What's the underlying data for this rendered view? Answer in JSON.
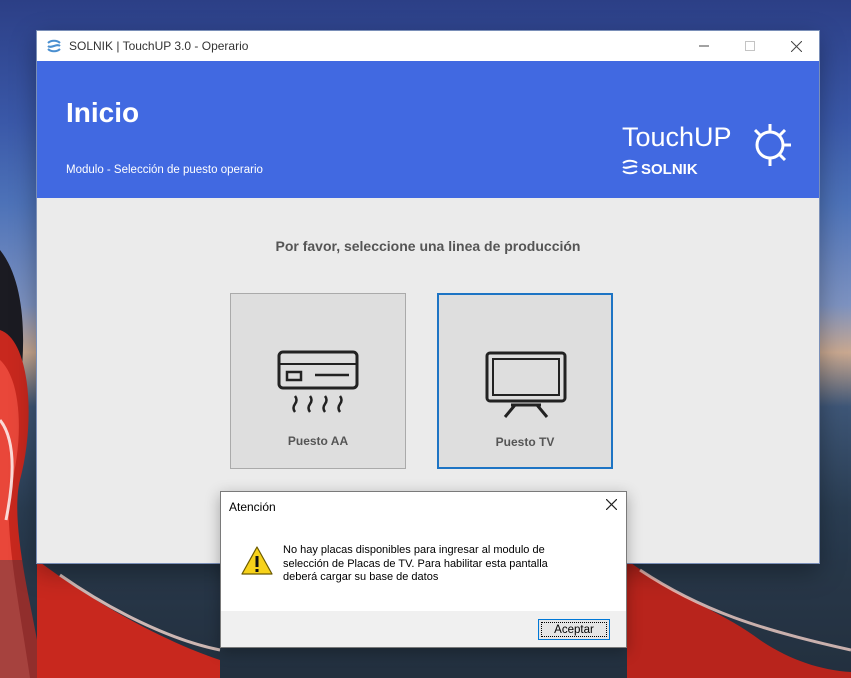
{
  "window": {
    "title": "SOLNIK | TouchUP 3.0 - Operario",
    "controls": [
      "minimize",
      "maximize",
      "close"
    ]
  },
  "header": {
    "title": "Inicio",
    "subtitle": "Modulo - Selección de puesto operario",
    "logo": {
      "product": "TouchUP",
      "brand": "SOLNIK"
    }
  },
  "main": {
    "prompt": "Por favor, seleccione una linea de producción",
    "options": [
      {
        "label": "Puesto AA",
        "icon": "air-conditioner-icon",
        "selected": false
      },
      {
        "label": "Puesto TV",
        "icon": "tv-icon",
        "selected": true
      }
    ]
  },
  "dialog": {
    "title": "Atención",
    "message": "No hay placas disponibles para ingresar al modulo de selección de Placas de TV. Para habilitar esta pantalla deberá cargar su base de datos",
    "icon": "warning-icon",
    "button_label": "Aceptar"
  },
  "colors": {
    "banner": "#4169e1",
    "selected_border": "#1d74c4",
    "warning_yellow": "#f7d21a"
  }
}
